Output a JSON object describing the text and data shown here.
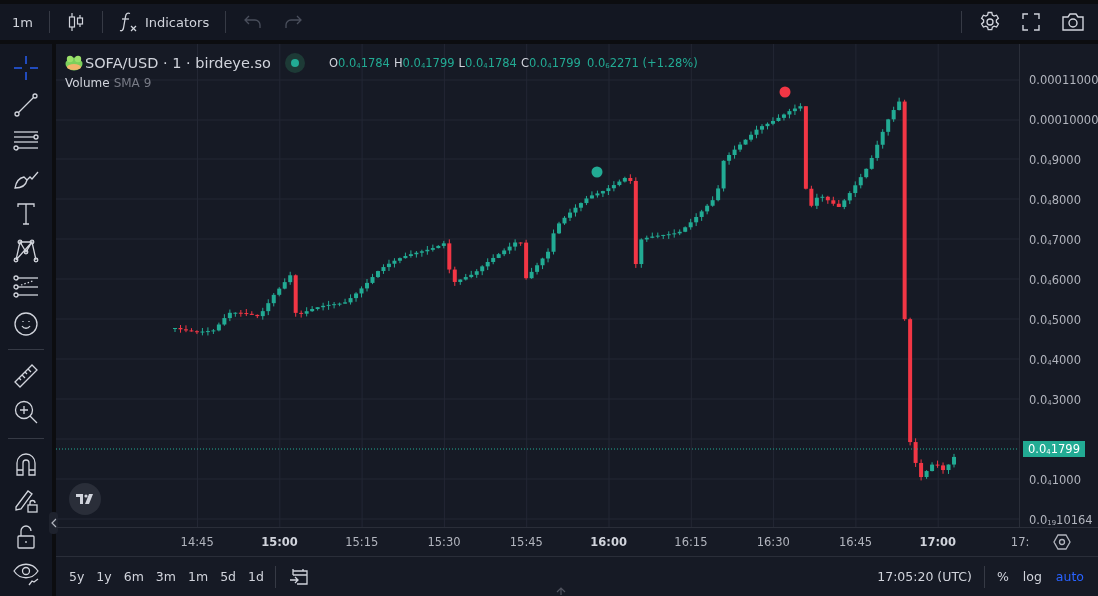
{
  "top_toolbar": {
    "interval": "1m",
    "indicators": "Indicators",
    "undo_disabled": true,
    "redo_disabled": true
  },
  "drawing_tools": [
    {
      "kind": "crosshair",
      "selected": true
    },
    {
      "kind": "trend-line",
      "selected": false
    },
    {
      "kind": "horizontal-lines",
      "selected": false
    },
    {
      "kind": "brush",
      "selected": false
    },
    {
      "kind": "text",
      "selected": false
    },
    {
      "kind": "pattern",
      "selected": false
    },
    {
      "kind": "projection",
      "selected": false
    },
    {
      "kind": "smiley",
      "selected": false
    },
    {
      "kind": "separator"
    },
    {
      "kind": "ruler",
      "selected": false
    },
    {
      "kind": "zoom-in",
      "selected": false
    },
    {
      "kind": "separator"
    },
    {
      "kind": "magnet",
      "selected": false
    },
    {
      "kind": "pencil-lock",
      "selected": false
    },
    {
      "kind": "lock",
      "selected": false
    },
    {
      "kind": "eye",
      "selected": false
    }
  ],
  "legend": {
    "symbol": "SOFA/USD · 1 · birdeye.so",
    "market_open": true,
    "ohlc": [
      {
        "label": "O",
        "value": "0.0$_{4}$1784"
      },
      {
        "label": "H",
        "value": "0.0$_{4}$1799"
      },
      {
        "label": "L",
        "value": "0.0$_{4}$1784"
      },
      {
        "label": "C",
        "value": "0.0$_{4}$1799"
      }
    ],
    "change": "0.0$_{6}$2271 (+1.28%)",
    "indicator": {
      "name": "Volume",
      "params": "SMA 9"
    }
  },
  "price_axis": {
    "labels": [
      "0.00011000",
      "0.00010000",
      "0.0$_{4}$9000",
      "0.0$_{4}$8000",
      "0.0$_{4}$7000",
      "0.0$_{4}$6000",
      "0.0$_{4}$5000",
      "0.0$_{4}$4000",
      "0.0$_{4}$3000",
      "0.0$_{4}$1000",
      "0.0$_{19}$10164"
    ],
    "current_price": "0.0$_{4}$1799"
  },
  "time_axis": [
    {
      "text": "14:45",
      "major": false
    },
    {
      "text": "15:00",
      "major": true
    },
    {
      "text": "15:15",
      "major": false
    },
    {
      "text": "15:30",
      "major": false
    },
    {
      "text": "15:45",
      "major": false
    },
    {
      "text": "16:00",
      "major": true
    },
    {
      "text": "16:15",
      "major": false
    },
    {
      "text": "16:30",
      "major": false
    },
    {
      "text": "16:45",
      "major": false
    },
    {
      "text": "17:00",
      "major": true
    },
    {
      "text": "17:",
      "major": false
    }
  ],
  "ranges": [
    "5y",
    "1y",
    "6m",
    "3m",
    "1m",
    "5d",
    "1d"
  ],
  "clock": "17:05:20 (UTC)",
  "scale_buttons": [
    {
      "label": "%",
      "selected": false
    },
    {
      "label": "log",
      "selected": false
    },
    {
      "label": "auto",
      "selected": true
    }
  ]
}
